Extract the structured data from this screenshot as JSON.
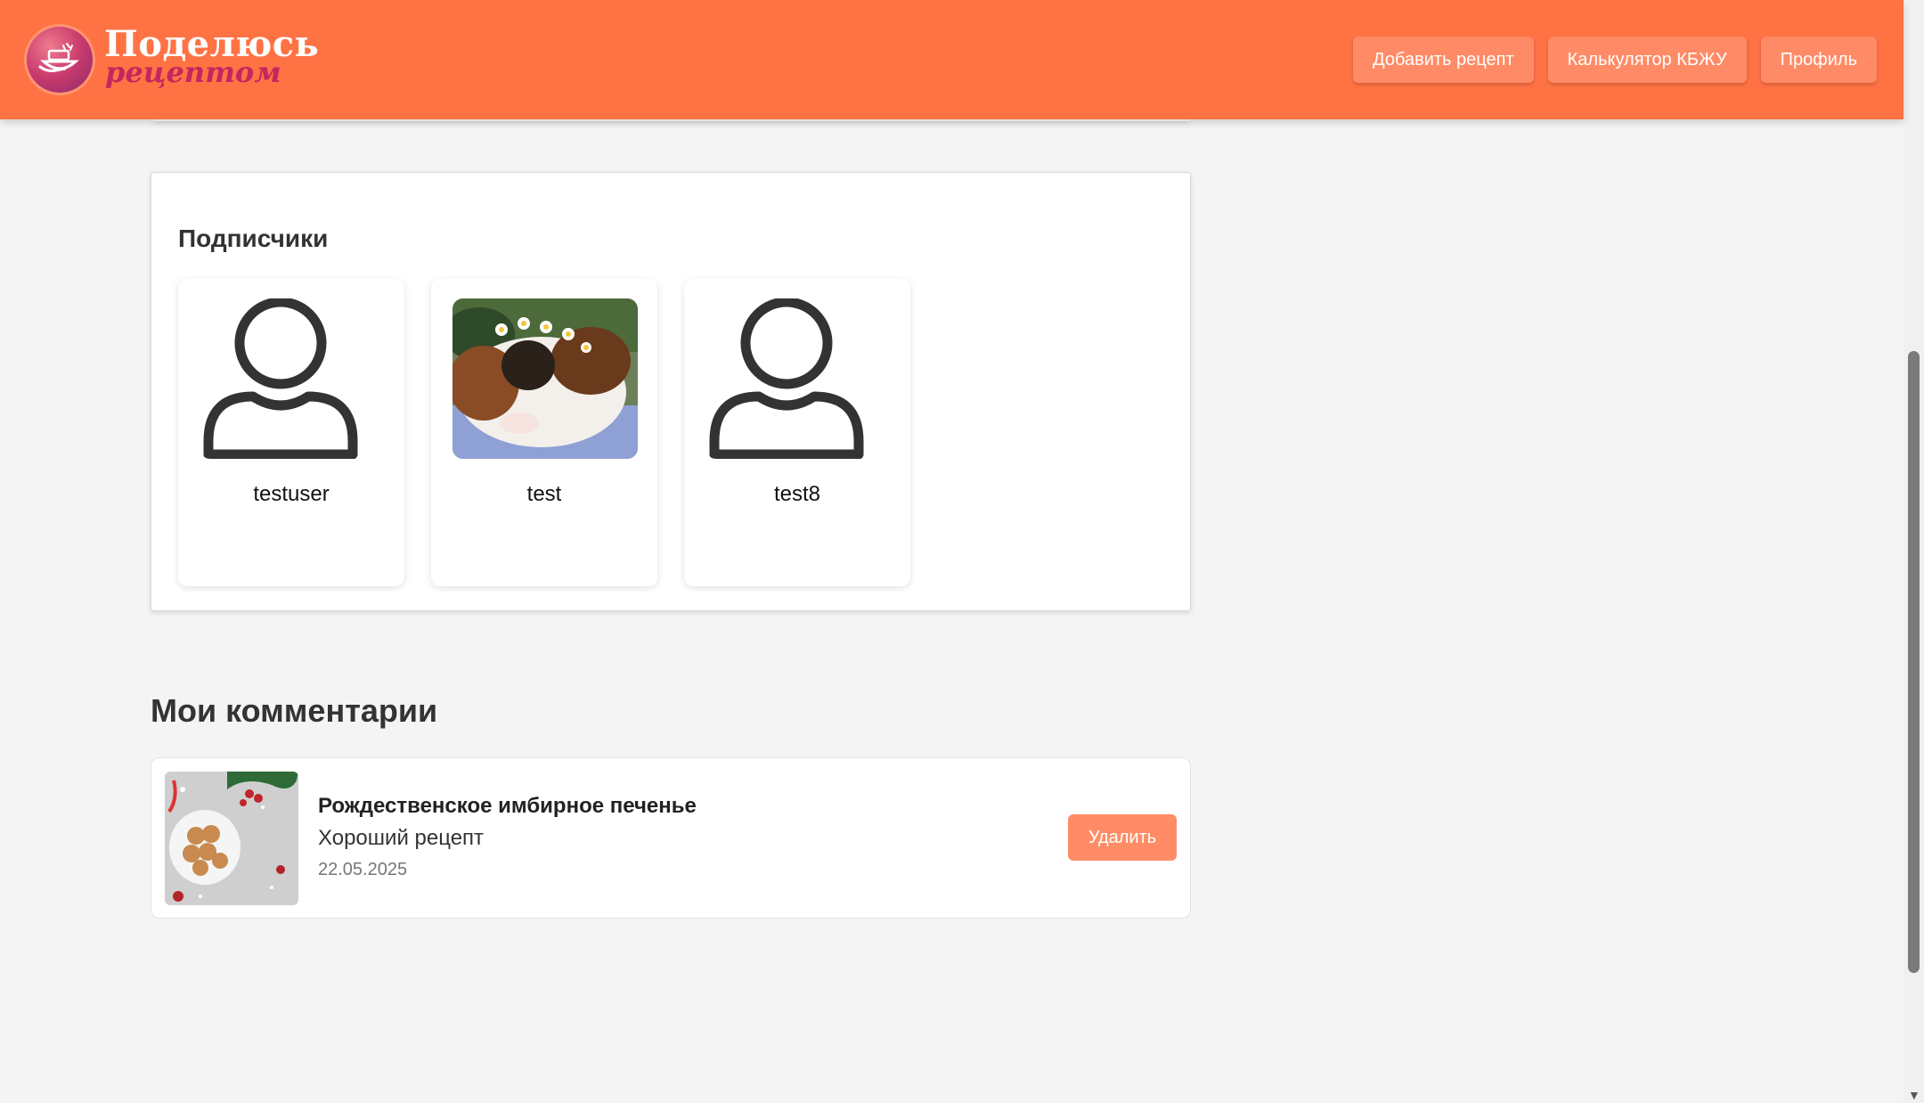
{
  "header": {
    "logo_line1": "Поделюсь",
    "logo_line2": "рецептом",
    "nav": {
      "add_recipe": "Добавить рецепт",
      "calculator": "Калькулятор КБЖУ",
      "profile": "Профиль"
    }
  },
  "subscribers": {
    "title": "Подписчики",
    "items": [
      {
        "name": "testuser",
        "avatar": "user-placeholder-icon"
      },
      {
        "name": "test",
        "avatar": "guinea-pig-photo"
      },
      {
        "name": "test8",
        "avatar": "user-placeholder-icon"
      }
    ]
  },
  "comments": {
    "title": "Мои комментарии",
    "items": [
      {
        "recipe": "Рождественское имбирное печенье",
        "text": "Хороший рецепт",
        "date": "22.05.2025",
        "delete_label": "Удалить"
      }
    ]
  },
  "colors": {
    "header_bg": "#ff7244",
    "nav_button": "#ff8b66",
    "delete_button": "#ff8c67",
    "page_bg": "#f4f4f4"
  }
}
